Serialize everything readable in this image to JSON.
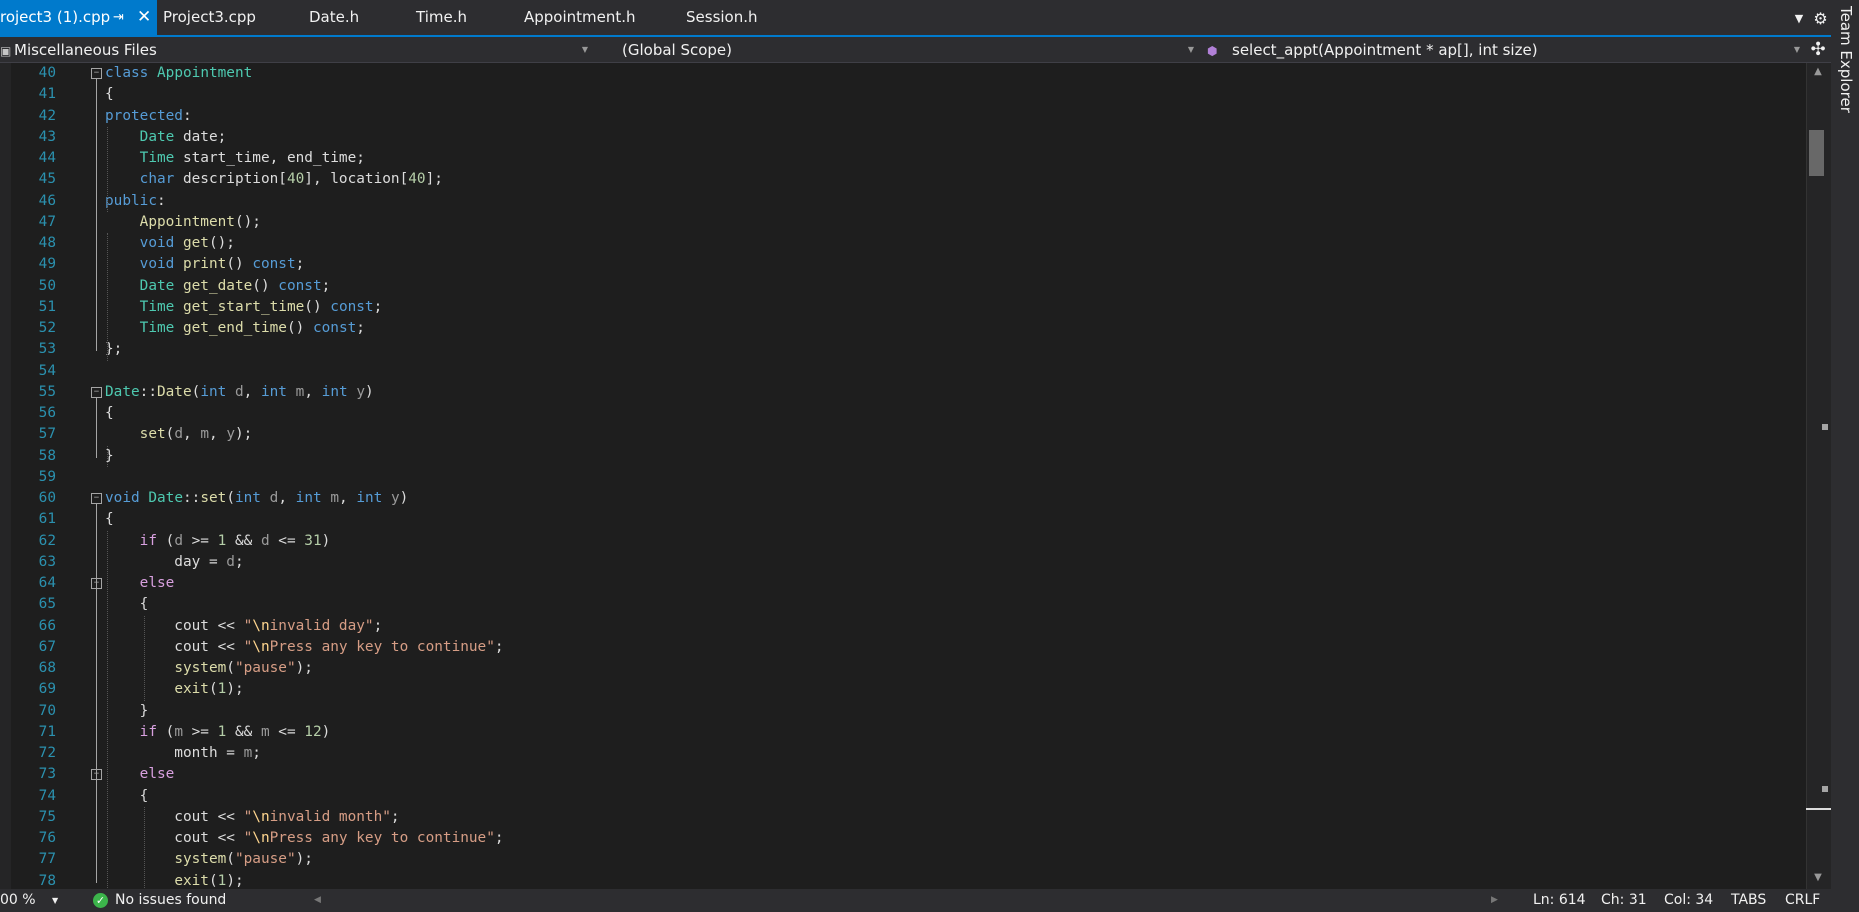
{
  "tabs": [
    {
      "label": "roject3 (1).cpp",
      "active": true,
      "pinned": true,
      "closable": true
    },
    {
      "label": "Project3.cpp"
    },
    {
      "label": "Date.h"
    },
    {
      "label": "Time.h"
    },
    {
      "label": "Appointment.h"
    },
    {
      "label": "Session.h"
    }
  ],
  "tab_actions": {
    "overflow_icon": "chevron-down-icon",
    "settings_icon": "gear-icon",
    "pin_icon": "pin-icon",
    "close_icon": "close-icon"
  },
  "nav": {
    "project": "Miscellaneous Files",
    "scope": "(Global Scope)",
    "member": "select_appt(Appointment * ap[], int size)",
    "project_icon": "project-icon",
    "member_icon": "method-icon",
    "split_icon": "split-editor-icon"
  },
  "side_panel": {
    "title": "Team Explorer"
  },
  "code_lines": [
    {
      "n": "40",
      "tokens": [
        [
          "kw",
          "class"
        ],
        [
          "tx",
          " "
        ],
        [
          "ty",
          "Appointment"
        ]
      ]
    },
    {
      "n": "41",
      "tokens": [
        [
          "tx",
          "{"
        ]
      ]
    },
    {
      "n": "42",
      "tokens": [
        [
          "kw",
          "protected"
        ],
        [
          "tx",
          ":"
        ]
      ]
    },
    {
      "n": "43",
      "tokens": [
        [
          "tx",
          "    "
        ],
        [
          "ty",
          "Date"
        ],
        [
          "tx",
          " date;"
        ]
      ]
    },
    {
      "n": "44",
      "tokens": [
        [
          "tx",
          "    "
        ],
        [
          "ty",
          "Time"
        ],
        [
          "tx",
          " start_time, end_time;"
        ]
      ]
    },
    {
      "n": "45",
      "tokens": [
        [
          "tx",
          "    "
        ],
        [
          "kw",
          "char"
        ],
        [
          "tx",
          " description["
        ],
        [
          "nm",
          "40"
        ],
        [
          "tx",
          "], location["
        ],
        [
          "nm",
          "40"
        ],
        [
          "tx",
          "];"
        ]
      ]
    },
    {
      "n": "46",
      "tokens": [
        [
          "kw",
          "public"
        ],
        [
          "tx",
          ":"
        ]
      ]
    },
    {
      "n": "47",
      "tokens": [
        [
          "tx",
          "    "
        ],
        [
          "fn",
          "Appointment"
        ],
        [
          "tx",
          "();"
        ]
      ]
    },
    {
      "n": "48",
      "tokens": [
        [
          "tx",
          "    "
        ],
        [
          "kw",
          "void"
        ],
        [
          "tx",
          " "
        ],
        [
          "fn",
          "get"
        ],
        [
          "tx",
          "();"
        ]
      ]
    },
    {
      "n": "49",
      "tokens": [
        [
          "tx",
          "    "
        ],
        [
          "kw",
          "void"
        ],
        [
          "tx",
          " "
        ],
        [
          "fn",
          "print"
        ],
        [
          "tx",
          "() "
        ],
        [
          "kw",
          "const"
        ],
        [
          "tx",
          ";"
        ]
      ]
    },
    {
      "n": "50",
      "tokens": [
        [
          "tx",
          "    "
        ],
        [
          "ty",
          "Date"
        ],
        [
          "tx",
          " "
        ],
        [
          "fn",
          "get_date"
        ],
        [
          "tx",
          "() "
        ],
        [
          "kw",
          "const"
        ],
        [
          "tx",
          ";"
        ]
      ]
    },
    {
      "n": "51",
      "tokens": [
        [
          "tx",
          "    "
        ],
        [
          "ty",
          "Time"
        ],
        [
          "tx",
          " "
        ],
        [
          "fn",
          "get_start_time"
        ],
        [
          "tx",
          "() "
        ],
        [
          "kw",
          "const"
        ],
        [
          "tx",
          ";"
        ]
      ]
    },
    {
      "n": "52",
      "tokens": [
        [
          "tx",
          "    "
        ],
        [
          "ty",
          "Time"
        ],
        [
          "tx",
          " "
        ],
        [
          "fn",
          "get_end_time"
        ],
        [
          "tx",
          "() "
        ],
        [
          "kw",
          "const"
        ],
        [
          "tx",
          ";"
        ]
      ]
    },
    {
      "n": "53",
      "tokens": [
        [
          "tx",
          "};"
        ]
      ]
    },
    {
      "n": "54",
      "tokens": []
    },
    {
      "n": "55",
      "tokens": [
        [
          "ty",
          "Date"
        ],
        [
          "tx",
          "::"
        ],
        [
          "fn",
          "Date"
        ],
        [
          "tx",
          "("
        ],
        [
          "kw",
          "int"
        ],
        [
          "tx",
          " "
        ],
        [
          "pa",
          "d"
        ],
        [
          "tx",
          ", "
        ],
        [
          "kw",
          "int"
        ],
        [
          "tx",
          " "
        ],
        [
          "pa",
          "m"
        ],
        [
          "tx",
          ", "
        ],
        [
          "kw",
          "int"
        ],
        [
          "tx",
          " "
        ],
        [
          "pa",
          "y"
        ],
        [
          "tx",
          ")"
        ]
      ]
    },
    {
      "n": "56",
      "tokens": [
        [
          "tx",
          "{"
        ]
      ]
    },
    {
      "n": "57",
      "tokens": [
        [
          "tx",
          "    "
        ],
        [
          "fn",
          "set"
        ],
        [
          "tx",
          "("
        ],
        [
          "pa",
          "d"
        ],
        [
          "tx",
          ", "
        ],
        [
          "pa",
          "m"
        ],
        [
          "tx",
          ", "
        ],
        [
          "pa",
          "y"
        ],
        [
          "tx",
          ");"
        ]
      ]
    },
    {
      "n": "58",
      "tokens": [
        [
          "tx",
          "}"
        ]
      ]
    },
    {
      "n": "59",
      "tokens": []
    },
    {
      "n": "60",
      "tokens": [
        [
          "kw",
          "void"
        ],
        [
          "tx",
          " "
        ],
        [
          "ty",
          "Date"
        ],
        [
          "tx",
          "::"
        ],
        [
          "fn",
          "set"
        ],
        [
          "tx",
          "("
        ],
        [
          "kw",
          "int"
        ],
        [
          "tx",
          " "
        ],
        [
          "pa",
          "d"
        ],
        [
          "tx",
          ", "
        ],
        [
          "kw",
          "int"
        ],
        [
          "tx",
          " "
        ],
        [
          "pa",
          "m"
        ],
        [
          "tx",
          ", "
        ],
        [
          "kw",
          "int"
        ],
        [
          "tx",
          " "
        ],
        [
          "pa",
          "y"
        ],
        [
          "tx",
          ")"
        ]
      ]
    },
    {
      "n": "61",
      "tokens": [
        [
          "tx",
          "{"
        ]
      ]
    },
    {
      "n": "62",
      "tokens": [
        [
          "tx",
          "    "
        ],
        [
          "ct",
          "if"
        ],
        [
          "tx",
          " ("
        ],
        [
          "pa",
          "d"
        ],
        [
          "tx",
          " >= "
        ],
        [
          "nm",
          "1"
        ],
        [
          "tx",
          " && "
        ],
        [
          "pa",
          "d"
        ],
        [
          "tx",
          " <= "
        ],
        [
          "nm",
          "31"
        ],
        [
          "tx",
          ")"
        ]
      ]
    },
    {
      "n": "63",
      "tokens": [
        [
          "tx",
          "        day = "
        ],
        [
          "pa",
          "d"
        ],
        [
          "tx",
          ";"
        ]
      ]
    },
    {
      "n": "64",
      "tokens": [
        [
          "tx",
          "    "
        ],
        [
          "ct",
          "else"
        ]
      ]
    },
    {
      "n": "65",
      "tokens": [
        [
          "tx",
          "    {"
        ]
      ]
    },
    {
      "n": "66",
      "tokens": [
        [
          "tx",
          "        cout << "
        ],
        [
          "st",
          "\""
        ],
        [
          "es",
          "\\n"
        ],
        [
          "st",
          "invalid day\""
        ],
        [
          "tx",
          ";"
        ]
      ]
    },
    {
      "n": "67",
      "tokens": [
        [
          "tx",
          "        cout << "
        ],
        [
          "st",
          "\""
        ],
        [
          "es",
          "\\n"
        ],
        [
          "st",
          "Press any key to continue\""
        ],
        [
          "tx",
          ";"
        ]
      ]
    },
    {
      "n": "68",
      "tokens": [
        [
          "tx",
          "        "
        ],
        [
          "fn",
          "system"
        ],
        [
          "tx",
          "("
        ],
        [
          "st",
          "\"pause\""
        ],
        [
          "tx",
          ");"
        ]
      ]
    },
    {
      "n": "69",
      "tokens": [
        [
          "tx",
          "        "
        ],
        [
          "fn",
          "exit"
        ],
        [
          "tx",
          "("
        ],
        [
          "nm",
          "1"
        ],
        [
          "tx",
          ");"
        ]
      ]
    },
    {
      "n": "70",
      "tokens": [
        [
          "tx",
          "    }"
        ]
      ]
    },
    {
      "n": "71",
      "tokens": [
        [
          "tx",
          "    "
        ],
        [
          "ct",
          "if"
        ],
        [
          "tx",
          " ("
        ],
        [
          "pa",
          "m"
        ],
        [
          "tx",
          " >= "
        ],
        [
          "nm",
          "1"
        ],
        [
          "tx",
          " && "
        ],
        [
          "pa",
          "m"
        ],
        [
          "tx",
          " <= "
        ],
        [
          "nm",
          "12"
        ],
        [
          "tx",
          ")"
        ]
      ]
    },
    {
      "n": "72",
      "tokens": [
        [
          "tx",
          "        month = "
        ],
        [
          "pa",
          "m"
        ],
        [
          "tx",
          ";"
        ]
      ]
    },
    {
      "n": "73",
      "tokens": [
        [
          "tx",
          "    "
        ],
        [
          "ct",
          "else"
        ]
      ]
    },
    {
      "n": "74",
      "tokens": [
        [
          "tx",
          "    {"
        ]
      ]
    },
    {
      "n": "75",
      "tokens": [
        [
          "tx",
          "        cout << "
        ],
        [
          "st",
          "\""
        ],
        [
          "es",
          "\\n"
        ],
        [
          "st",
          "invalid month\""
        ],
        [
          "tx",
          ";"
        ]
      ]
    },
    {
      "n": "76",
      "tokens": [
        [
          "tx",
          "        cout << "
        ],
        [
          "st",
          "\""
        ],
        [
          "es",
          "\\n"
        ],
        [
          "st",
          "Press any key to continue\""
        ],
        [
          "tx",
          ";"
        ]
      ]
    },
    {
      "n": "77",
      "tokens": [
        [
          "tx",
          "        "
        ],
        [
          "fn",
          "system"
        ],
        [
          "tx",
          "("
        ],
        [
          "st",
          "\"pause\""
        ],
        [
          "tx",
          ");"
        ]
      ]
    },
    {
      "n": "78",
      "tokens": [
        [
          "tx",
          "        "
        ],
        [
          "fn",
          "exit"
        ],
        [
          "tx",
          "("
        ],
        [
          "nm",
          "1"
        ],
        [
          "tx",
          ");"
        ]
      ]
    }
  ],
  "status": {
    "zoom": "00 %",
    "issues": "No issues found",
    "ln": "Ln: 614",
    "ch": "Ch: 31",
    "col": "Col: 34",
    "indent": "TABS",
    "eol": "CRLF"
  },
  "colors": {
    "accent": "#007acc",
    "keyword": "#569cd6",
    "type": "#4ec9b0",
    "function": "#dcdcaa",
    "string": "#d69d85",
    "escape": "#ffd68f",
    "number": "#b5cea8",
    "parameter": "#9a9a9a",
    "control": "#d8a0df",
    "line_number": "#2b91af"
  }
}
